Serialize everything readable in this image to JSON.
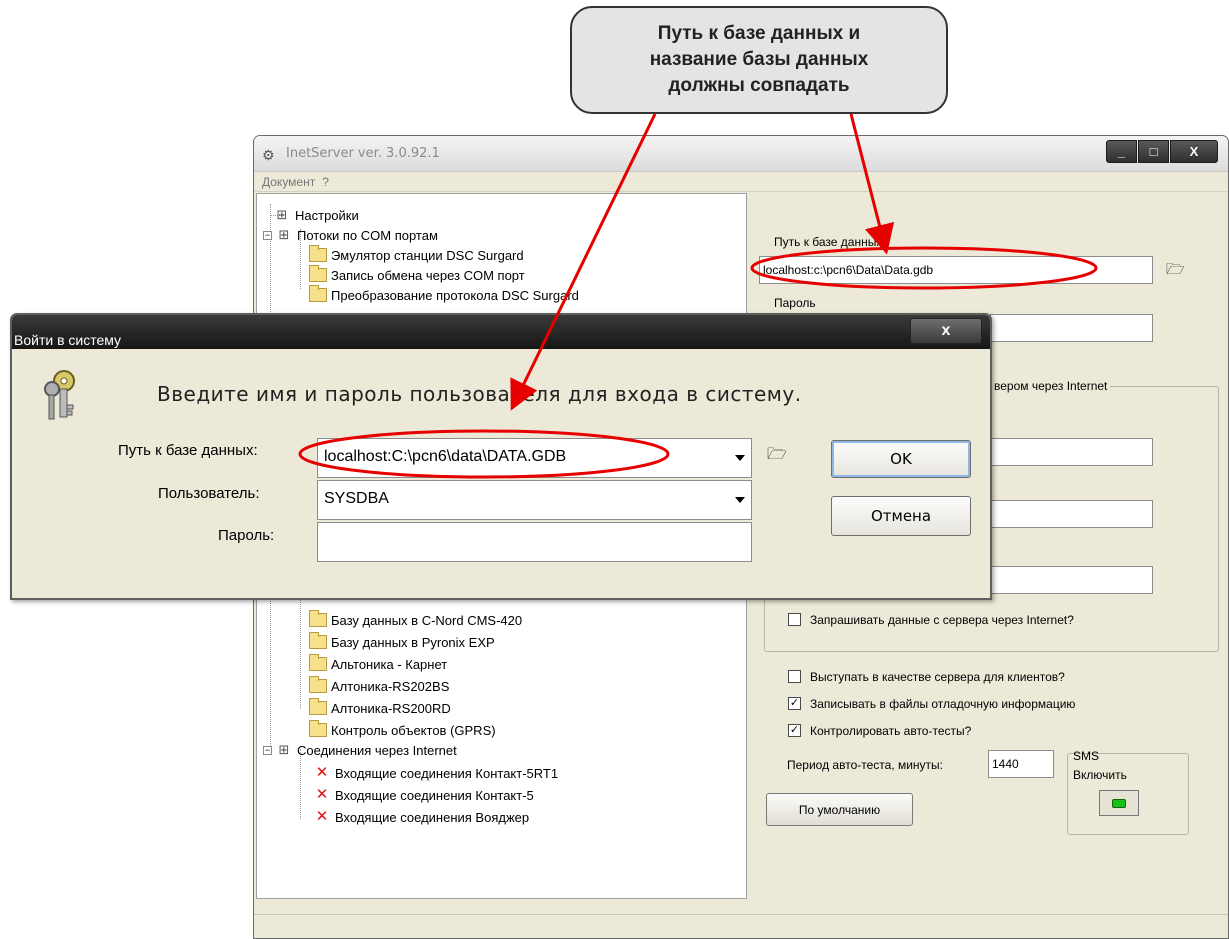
{
  "callout": {
    "lines": [
      "Путь к базе данных и",
      "название базы данных",
      "должны совпадать"
    ]
  },
  "main_window": {
    "title": "InetServer ver. 3.0.92.1",
    "controls": {
      "minimize": "_",
      "maximize": "□",
      "close": "X"
    },
    "menu": [
      "Документ",
      "?"
    ],
    "tree": {
      "settings": "Настройки",
      "com_streams": "Потоки по COM портам",
      "com_children": [
        "Эмулятор станции DSC Surgard",
        "Запись обмена через COM порт",
        "Преобразование протокола DSC Surgard"
      ],
      "export_children": [
        "Базу данных в C-Nord CMS-420",
        "Базу данных в Pyronix EXP",
        "Альтоника - Карнет",
        "Алтоника-RS202BS",
        "Алтоника-RS200RD",
        "Контроль объектов (GPRS)"
      ],
      "internet": "Соединения через Internet",
      "internet_children": [
        "Входящие соединения Контакт-5RT1",
        "Входящие соединения Контакт-5",
        "Входящие соединения Вояджер"
      ]
    },
    "right": {
      "db_path_label": "Путь к базе данных",
      "db_path_value": "localhost:c:\\pcn6\\Data\\Data.gdb",
      "password_label": "Пароль",
      "group_title": "вером через Internet",
      "request_data": "Запрашивать данные с сервера через Internet?",
      "act_server": "Выступать в качестве сервера для клиентов?",
      "write_debug": "Записывать в файлы отладочную информацию",
      "control_autotests": "Контролировать авто-тесты?",
      "period_label": "Период авто-теста, минуты:",
      "period_value": "1440",
      "sms_title": "SMS",
      "sms_enable": "Включить",
      "defaults_button": "По умолчанию",
      "checks": {
        "request_data": false,
        "act_server": false,
        "write_debug": true,
        "control_autotests": true
      }
    }
  },
  "login_dialog": {
    "title": "Войти в систему",
    "close": "x",
    "heading": "Введите имя и пароль пользователя для входа в систему.",
    "db_label": "Путь к базе данных:",
    "db_value": "localhost:C:\\pcn6\\data\\DATA.GDB",
    "user_label": "Пользователь:",
    "user_value": "SYSDBA",
    "password_label": "Пароль:",
    "password_value": "",
    "ok": "OK",
    "cancel": "Отмена"
  },
  "colors": {
    "annotation": "#e60000",
    "led": "#19c119"
  }
}
